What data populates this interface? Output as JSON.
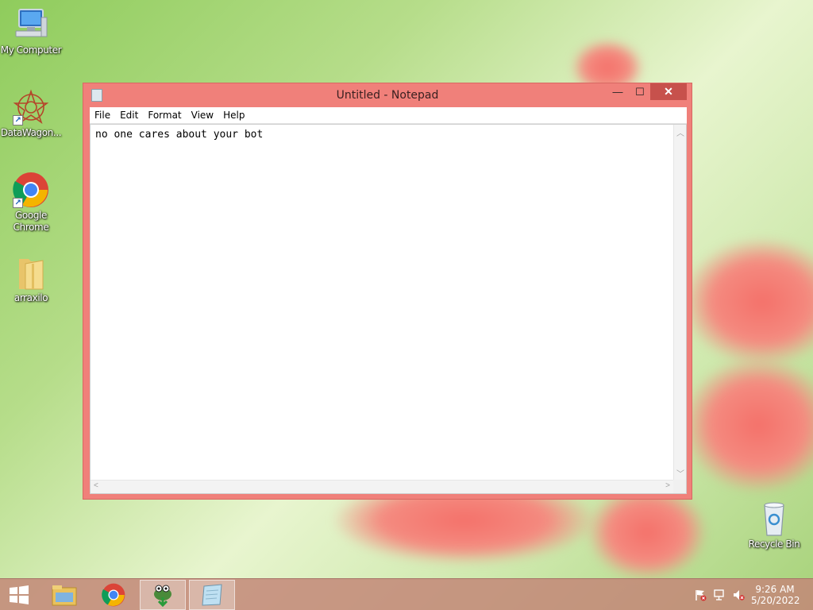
{
  "desktop": {
    "icons": [
      {
        "label": "My Computer",
        "icon": "computer-icon"
      },
      {
        "label": "DataWagon...",
        "icon": "datawagon-icon"
      },
      {
        "label": "Google Chrome",
        "icon": "chrome-icon"
      },
      {
        "label": "arraxilo",
        "icon": "folder-icon"
      },
      {
        "label": "Recycle Bin",
        "icon": "recycle-bin-icon"
      }
    ]
  },
  "notepad": {
    "title": "Untitled - Notepad",
    "menu": [
      "File",
      "Edit",
      "Format",
      "View",
      "Help"
    ],
    "content": "no one cares about your bot",
    "controls": {
      "minimize": "—",
      "maximize": "☐",
      "close": "✕"
    }
  },
  "taskbar": {
    "items": [
      "start-button",
      "file-explorer-icon",
      "chrome-icon",
      "app-icon",
      "notepad-icon"
    ],
    "active": "notepad-icon",
    "clock": {
      "time": "9:26 AM",
      "date": "5/20/2022"
    }
  },
  "colors": {
    "window_frame": "#f0807a",
    "close_button": "#c7514c",
    "taskbar": "#c38778"
  }
}
